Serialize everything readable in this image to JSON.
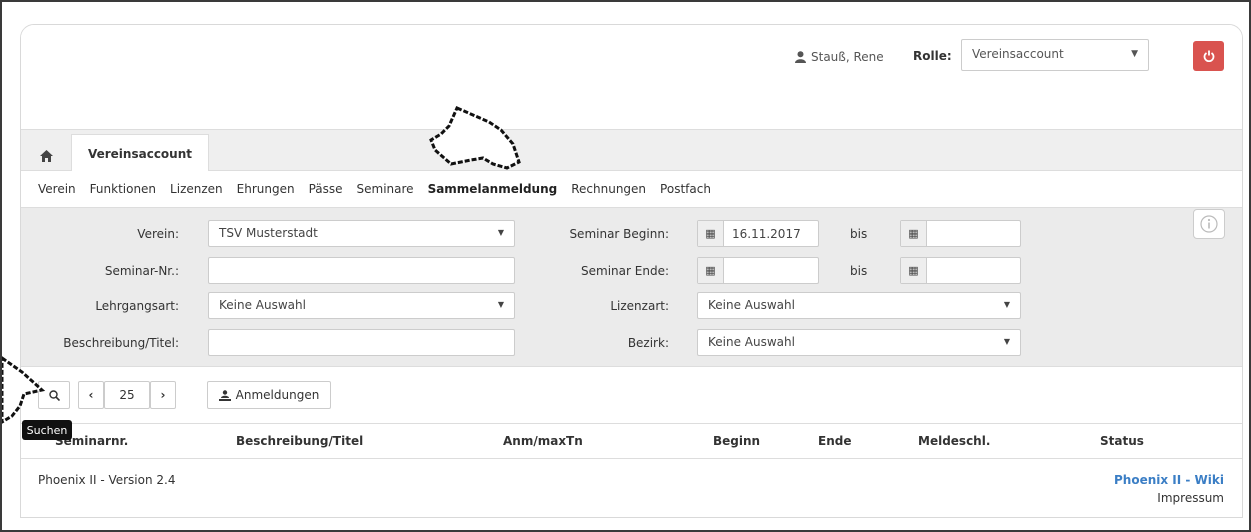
{
  "header": {
    "user_name": "Stauß, Rene",
    "role_label": "Rolle:",
    "role_value": "Vereinsaccount",
    "user_icon": "user-icon",
    "power_icon": "power-icon"
  },
  "tabs": {
    "home_icon": "home-icon",
    "main_tab": "Vereinsaccount"
  },
  "subnav": [
    {
      "label": "Verein"
    },
    {
      "label": "Funktionen"
    },
    {
      "label": "Lizenzen"
    },
    {
      "label": "Ehrungen"
    },
    {
      "label": "Pässe"
    },
    {
      "label": "Seminare"
    },
    {
      "label": "Sammelanmeldung",
      "active": true
    },
    {
      "label": "Rechnungen"
    },
    {
      "label": "Postfach"
    }
  ],
  "filter": {
    "verein_label": "Verein:",
    "verein_value": "TSV Musterstadt",
    "seminar_nr_label": "Seminar-Nr.:",
    "seminar_nr_value": "",
    "lehrgangsart_label": "Lehrgangsart:",
    "lehrgangsart_value": "Keine Auswahl",
    "beschreibung_label": "Beschreibung/Titel:",
    "beschreibung_value": "",
    "seminar_beginn_label": "Seminar Beginn:",
    "seminar_beginn_from": "16.11.2017",
    "seminar_beginn_to": "",
    "seminar_ende_label": "Seminar Ende:",
    "seminar_ende_from": "",
    "seminar_ende_to": "",
    "bis_label": "bis",
    "lizenzart_label": "Lizenzart:",
    "lizenzart_value": "Keine Auswahl",
    "bezirk_label": "Bezirk:",
    "bezirk_value": "Keine Auswahl",
    "info_icon": "info-icon"
  },
  "toolbar": {
    "search_icon": "search-icon",
    "page_size": "25",
    "anmeldungen_label": "Anmeldungen",
    "tooltip": "Suchen"
  },
  "table": {
    "columns": [
      "Seminarnr.",
      "Beschreibung/Titel",
      "Anm/maxTn",
      "Beginn",
      "Ende",
      "Meldeschl.",
      "Status"
    ]
  },
  "footer": {
    "version": "Phoenix II - Version 2.4",
    "wiki": "Phoenix II - Wiki",
    "impressum": "Impressum"
  },
  "colors": {
    "accent_red": "#d9534f",
    "link_blue": "#3b7ec5",
    "panel_grey": "#ebebeb"
  }
}
